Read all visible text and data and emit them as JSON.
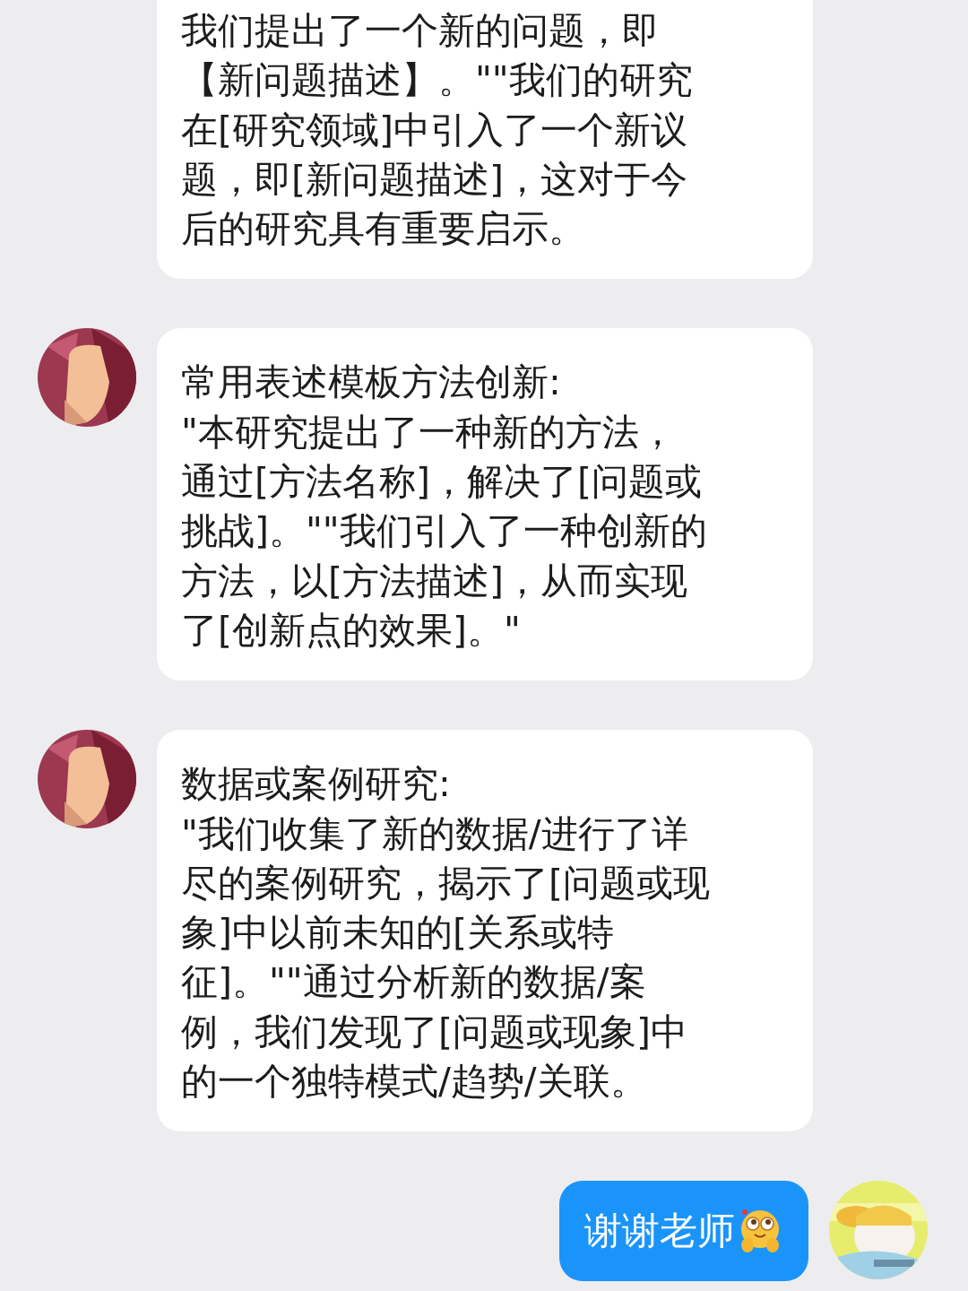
{
  "messages": [
    {
      "kind": "received",
      "show_avatar": false,
      "lines": [
        "我们提出了一个新的问题，即",
        "【新问题描述】。\"\"我们的研究",
        "在[研究领域]中引入了一个新议",
        "题，即[新问题描述]，这对于今",
        "后的研究具有重要启示。"
      ]
    },
    {
      "kind": "received",
      "show_avatar": true,
      "lines": [
        "常用表述模板方法创新:",
        "\"本研究提出了一种新的方法，",
        "通过[方法名称]，解决了[问题或",
        "挑战]。\"\"我们引入了一种创新的",
        "方法，以[方法描述]，从而实现",
        "了[创新点的效果]。\""
      ]
    },
    {
      "kind": "received",
      "show_avatar": true,
      "lines": [
        "数据或案例研究:",
        "\"我们收集了新的数据/进行了详",
        "尽的案例研究，揭示了[问题或现",
        "象]中以前未知的[关系或特",
        "征]。\"\"通过分析新的数据/案",
        "例，我们发现了[问题或现象]中",
        "的一个独特模式/趋势/关联。"
      ]
    },
    {
      "kind": "sent",
      "show_avatar": true,
      "emoji": true,
      "lines": [
        "谢谢老师"
      ]
    }
  ]
}
